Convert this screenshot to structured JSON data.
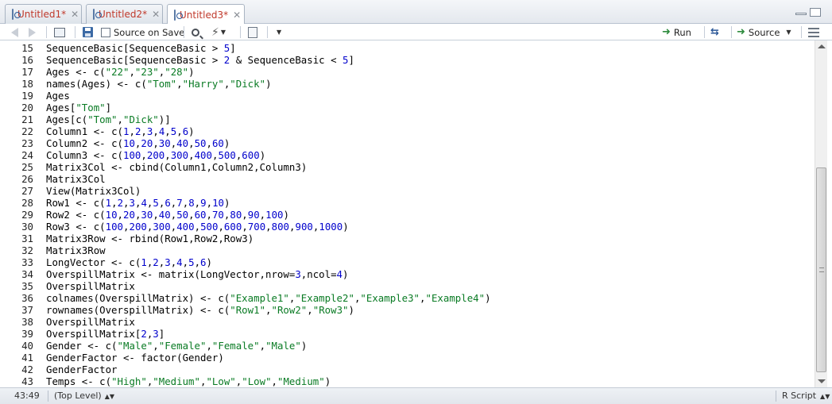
{
  "tabs": [
    {
      "label": "Untitled1*",
      "active": false
    },
    {
      "label": "Untitled2*",
      "active": false
    },
    {
      "label": "Untitled3*",
      "active": true
    }
  ],
  "toolbar": {
    "source_on_save": "Source on Save",
    "run": "Run",
    "source": "Source"
  },
  "editor": {
    "lines": [
      {
        "n": "15",
        "code": "SequenceBasic[SequenceBasic > 5]"
      },
      {
        "n": "16",
        "code": "SequenceBasic[SequenceBasic > 2 & SequenceBasic < 5]"
      },
      {
        "n": "17",
        "code": "Ages <- c(\"22\",\"23\",\"28\")"
      },
      {
        "n": "18",
        "code": "names(Ages) <- c(\"Tom\",\"Harry\",\"Dick\")"
      },
      {
        "n": "19",
        "code": "Ages"
      },
      {
        "n": "20",
        "code": "Ages[\"Tom\"]"
      },
      {
        "n": "21",
        "code": "Ages[c(\"Tom\",\"Dick\")]"
      },
      {
        "n": "22",
        "code": "Column1 <- c(1,2,3,4,5,6)"
      },
      {
        "n": "23",
        "code": "Column2 <- c(10,20,30,40,50,60)"
      },
      {
        "n": "24",
        "code": "Column3 <- c(100,200,300,400,500,600)"
      },
      {
        "n": "25",
        "code": "Matrix3Col <- cbind(Column1,Column2,Column3)"
      },
      {
        "n": "26",
        "code": "Matrix3Col"
      },
      {
        "n": "27",
        "code": "View(Matrix3Col)"
      },
      {
        "n": "28",
        "code": "Row1 <- c(1,2,3,4,5,6,7,8,9,10)"
      },
      {
        "n": "29",
        "code": "Row2 <- c(10,20,30,40,50,60,70,80,90,100)"
      },
      {
        "n": "30",
        "code": "Row3 <- c(100,200,300,400,500,600,700,800,900,1000)"
      },
      {
        "n": "31",
        "code": "Matrix3Row <- rbind(Row1,Row2,Row3)"
      },
      {
        "n": "32",
        "code": "Matrix3Row"
      },
      {
        "n": "33",
        "code": "LongVector <- c(1,2,3,4,5,6)"
      },
      {
        "n": "34",
        "code": "OverspillMatrix <- matrix(LongVector,nrow=3,ncol=4)"
      },
      {
        "n": "35",
        "code": "OverspillMatrix"
      },
      {
        "n": "36",
        "code": "colnames(OverspillMatrix) <- c(\"Example1\",\"Example2\",\"Example3\",\"Example4\")"
      },
      {
        "n": "37",
        "code": "rownames(OverspillMatrix) <- c(\"Row1\",\"Row2\",\"Row3\")"
      },
      {
        "n": "38",
        "code": "OverspillMatrix"
      },
      {
        "n": "39",
        "code": "OverspillMatrix[2,3]"
      },
      {
        "n": "40",
        "code": "Gender <- c(\"Male\",\"Female\",\"Female\",\"Male\")"
      },
      {
        "n": "41",
        "code": "GenderFactor <- factor(Gender)"
      },
      {
        "n": "42",
        "code": "GenderFactor"
      },
      {
        "n": "43",
        "code": "Temps <- c(\"High\",\"Medium\",\"Low\",\"Low\",\"Medium\")"
      }
    ]
  },
  "status": {
    "position": "43:49",
    "scope": "(Top Level)",
    "file_type": "R Script"
  },
  "colors": {
    "string": "#0a7b24",
    "number": "#0000cc",
    "tab_text": "#c0392b"
  }
}
